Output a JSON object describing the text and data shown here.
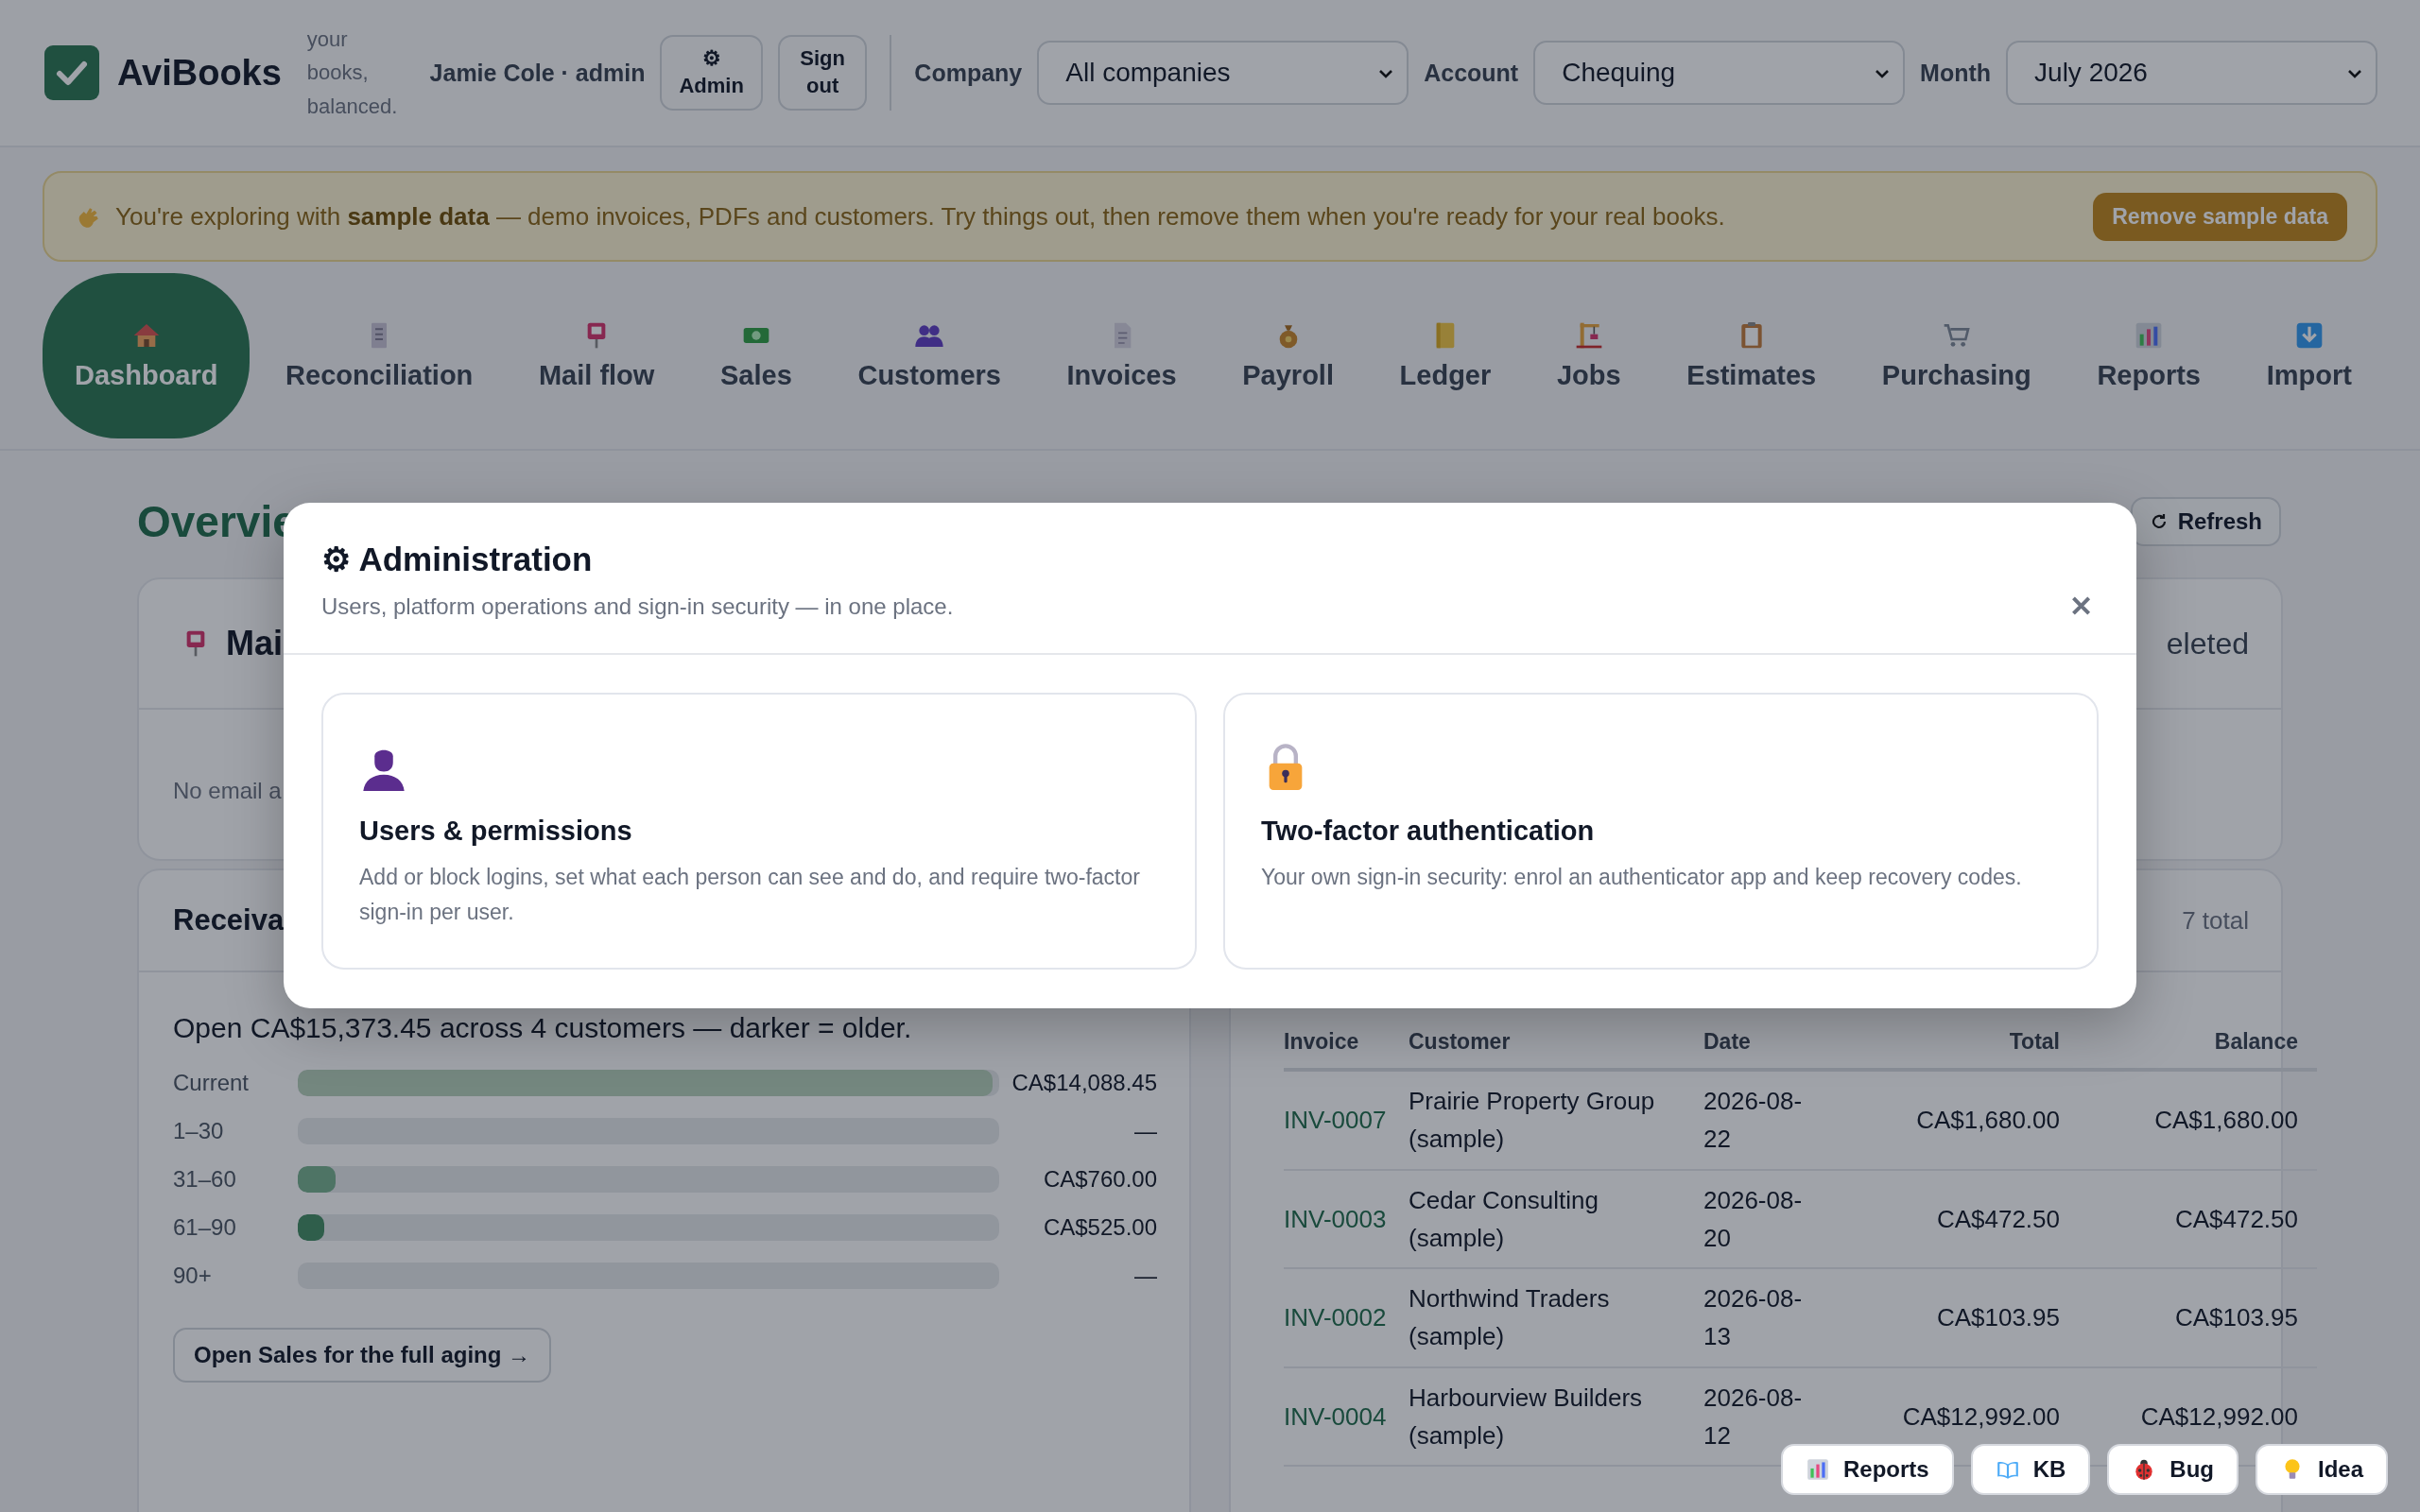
{
  "app": {
    "name": "AviBooks",
    "tagline": "your books, balanced.",
    "user": "Jamie Cole · admin"
  },
  "admin_button": {
    "glyph": "⚙",
    "label": "Admin"
  },
  "sign_out_button": "Sign out",
  "filters": [
    {
      "label": "Company",
      "value": "All companies"
    },
    {
      "label": "Account",
      "value": "Chequing"
    },
    {
      "label": "Month",
      "value": "July 2026"
    }
  ],
  "banner": {
    "text": "You're exploring with **sample data** — demo invoices, PDFs and customers. Try things out, then remove them when you're ready for your real books.",
    "button": "Remove sample data"
  },
  "nav": [
    {
      "label": "Dashboard",
      "selected": true
    },
    {
      "label": "Reconciliation",
      "selected": false
    },
    {
      "label": "Mail flow",
      "selected": false
    },
    {
      "label": "Sales",
      "selected": false
    },
    {
      "label": "Customers",
      "selected": false
    },
    {
      "label": "Invoices",
      "selected": false
    },
    {
      "label": "Payroll",
      "selected": false
    },
    {
      "label": "Ledger",
      "selected": false
    },
    {
      "label": "Jobs",
      "selected": false
    },
    {
      "label": "Estimates",
      "selected": false
    },
    {
      "label": "Purchasing",
      "selected": false
    },
    {
      "label": "Reports",
      "selected": false
    },
    {
      "label": "Import",
      "selected": false
    }
  ],
  "overview": {
    "title": "Overvie",
    "refresh": "Refresh"
  },
  "mail_card": {
    "title": "Mai",
    "empty_text": "No email a"
  },
  "status_card": {
    "text": "eleted"
  },
  "receivables": {
    "title": "Receiva",
    "summary": "Open CA$15,373.45 across 4 customers — darker = older.",
    "aging": [
      {
        "bucket": "Current",
        "level": 0.99,
        "color": "#74877f",
        "amount": "CA$14,088.45"
      },
      {
        "bucket": "1–30",
        "amount": "—"
      },
      {
        "bucket": "31–60",
        "level": 0.054,
        "color": "#4e7465",
        "amount": "CA$760.00"
      },
      {
        "bucket": "61–90",
        "level": 0.038,
        "color": "#2f5e4b",
        "amount": "CA$525.00"
      },
      {
        "bucket": "90+",
        "amount": "—"
      }
    ],
    "link": "Open Sales for the full aging →"
  },
  "invoices": {
    "count": "7 total",
    "columns": [
      "Invoice",
      "Customer",
      "Date",
      "Total",
      "Balance"
    ],
    "rows": [
      {
        "invoice": "INV-0007",
        "customer": "Prairie Property Group (sample)",
        "date": "2026-08-22",
        "total": "CA$1,680.00",
        "balance": "CA$1,680.00"
      },
      {
        "invoice": "INV-0003",
        "customer": "Cedar Consulting (sample)",
        "date": "2026-08-20",
        "total": "CA$472.50",
        "balance": "CA$472.50"
      },
      {
        "invoice": "INV-0002",
        "customer": "Northwind Traders (sample)",
        "date": "2026-08-13",
        "total": "CA$103.95",
        "balance": "CA$103.95"
      },
      {
        "invoice": "INV-0004",
        "customer": "Harbourview Builders (sample)",
        "date": "2026-08-12",
        "total": "CA$12,992.00",
        "balance": "CA$12,992.00"
      }
    ]
  },
  "modal": {
    "glyph": "⚙",
    "title": "Administration",
    "subtitle": "Users, platform operations and sign-in security — in one place.",
    "close": "✕",
    "cards": [
      {
        "title": "Users & permissions",
        "text": "Add or block logins, set what each person can see and do, and require two-factor sign-in per user."
      },
      {
        "title": "Two-factor authentication",
        "text": "Your own sign-in security: enrol an authenticator app and keep recovery codes."
      }
    ]
  },
  "quick_links": [
    {
      "label": "Reports"
    },
    {
      "label": "KB"
    },
    {
      "label": "Bug"
    },
    {
      "label": "Idea"
    }
  ]
}
